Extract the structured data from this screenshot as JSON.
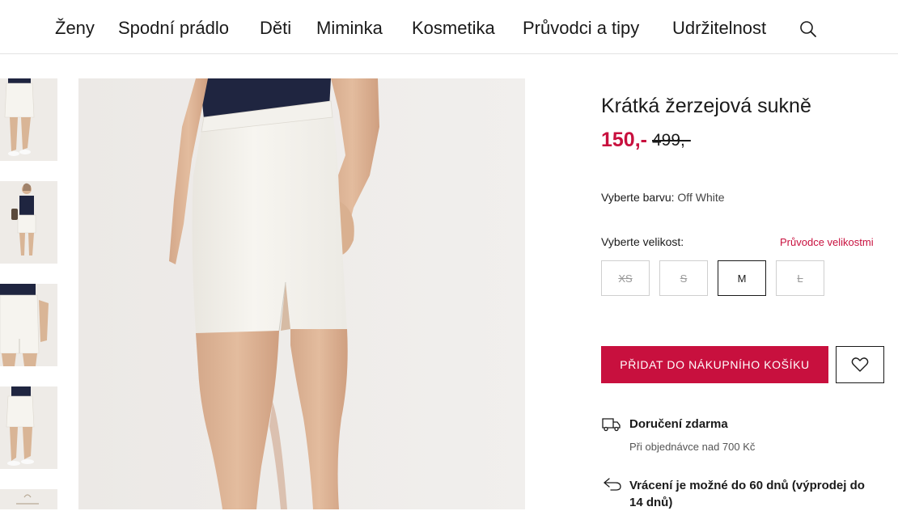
{
  "nav": {
    "items": [
      "Ženy",
      "Spodní prádlo",
      "Děti",
      "Miminka",
      "Kosmetika",
      "Průvodci a tipy",
      "Udržitelnost"
    ],
    "search_icon": "search-icon"
  },
  "product": {
    "title": "Krátká žerzejová sukně",
    "price_sale": "150,-",
    "price_original": "499,-",
    "color_label": "Vyberte barvu:",
    "color_value": "Off White",
    "size_label": "Vyberte velikost:",
    "size_guide": "Průvodce velikostmi",
    "sizes": [
      {
        "label": "XS",
        "available": false
      },
      {
        "label": "S",
        "available": false
      },
      {
        "label": "M",
        "available": true,
        "selected": true
      },
      {
        "label": "L",
        "available": false
      }
    ],
    "add_to_cart": "PŘIDAT DO NÁKUPNÍHO KOŠÍKU",
    "wishlist_icon": "heart-icon"
  },
  "benefits": [
    {
      "icon": "truck-icon",
      "title": "Doručení zdarma",
      "subtitle": "Při objednávce nad 700 Kč"
    },
    {
      "icon": "return-arrow-icon",
      "title": "Vrácení je možné do 60 dnů (výprodej do 14 dnů)",
      "subtitle": ""
    }
  ],
  "colors": {
    "accent": "#c8103e",
    "text": "#1a1a1a",
    "skirt": "#f4f2ec",
    "top": "#1f2540"
  }
}
